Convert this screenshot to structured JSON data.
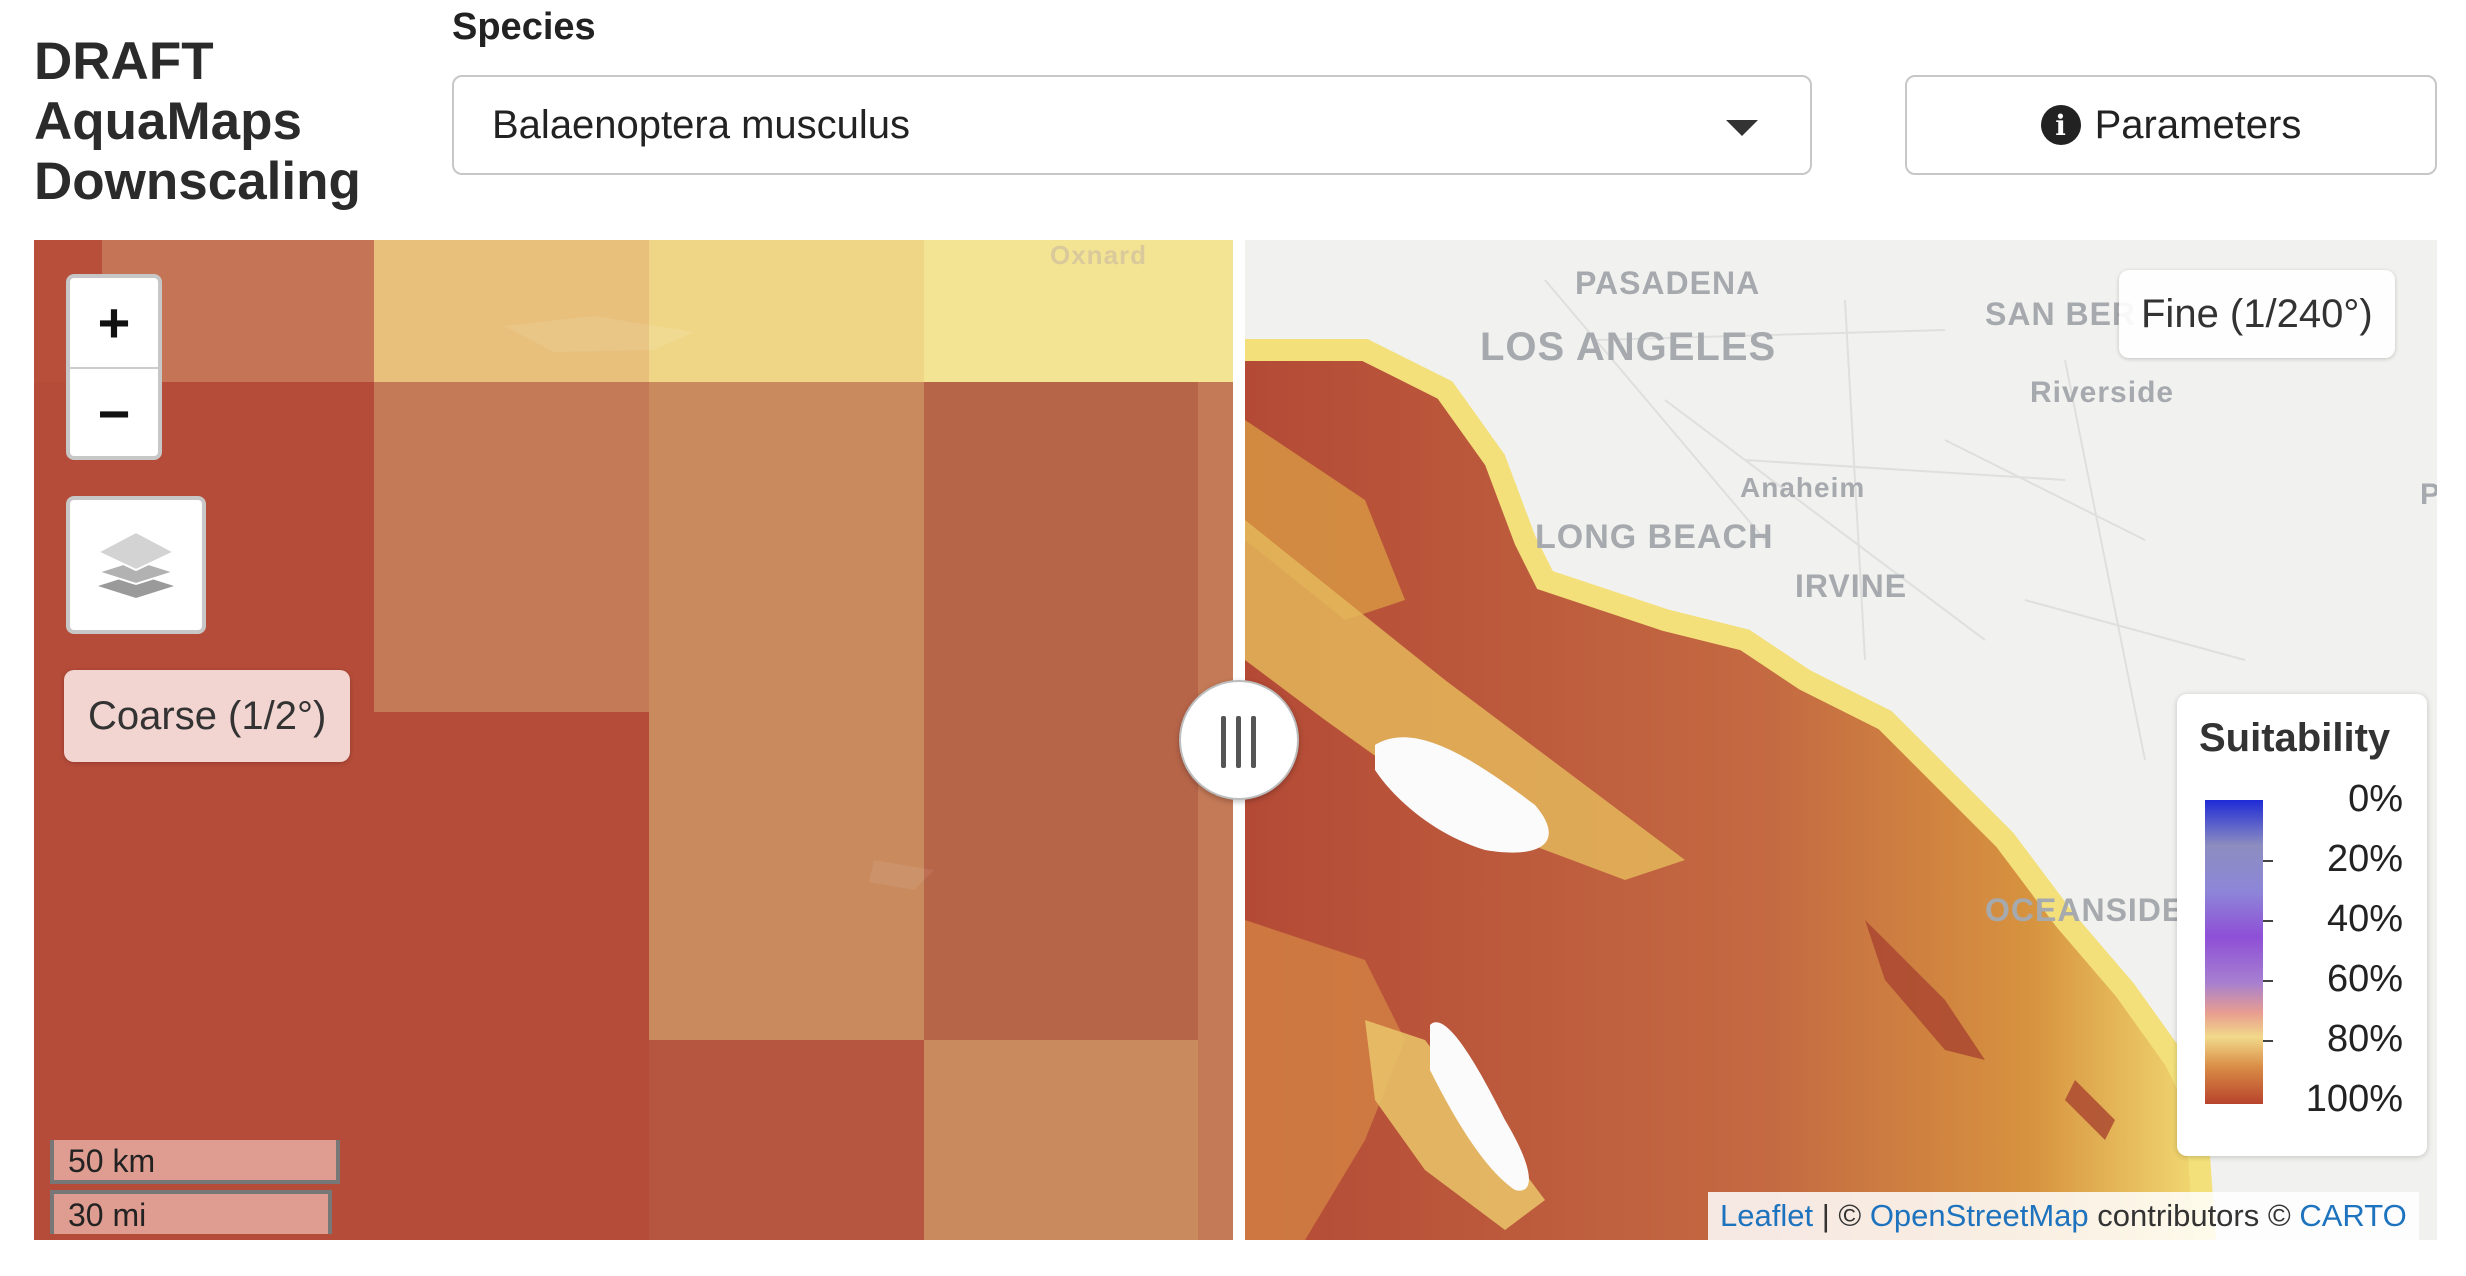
{
  "app": {
    "title": "DRAFT AquaMaps Downscaling"
  },
  "species": {
    "label": "Species",
    "selected": "Balaenoptera musculus"
  },
  "parameters_button": {
    "label": "Parameters"
  },
  "map": {
    "zoom_in": "+",
    "zoom_out": "−",
    "coarse_label": "Coarse (1/2°)",
    "fine_label": "Fine (1/240°)",
    "scale_km": "50 km",
    "scale_mi": "30 mi",
    "place_labels": {
      "oxnard": "Oxnard",
      "pasadena": "PASADENA",
      "los_angeles": "LOS ANGELES",
      "san_bernardino": "SAN BER",
      "riverside": "Riverside",
      "anaheim": "Anaheim",
      "long_beach": "LONG BEACH",
      "irvine": "IRVINE",
      "oceanside": "OCEANSIDE",
      "edge_p": "P"
    },
    "legend": {
      "title": "Suitability",
      "labels": [
        "0%",
        "20%",
        "40%",
        "60%",
        "80%",
        "100%"
      ]
    },
    "attribution": {
      "leaflet": "Leaflet",
      "sep": " | © ",
      "osm": "OpenStreetMap",
      "contributors": " contributors © ",
      "carto": "CARTO"
    }
  }
}
